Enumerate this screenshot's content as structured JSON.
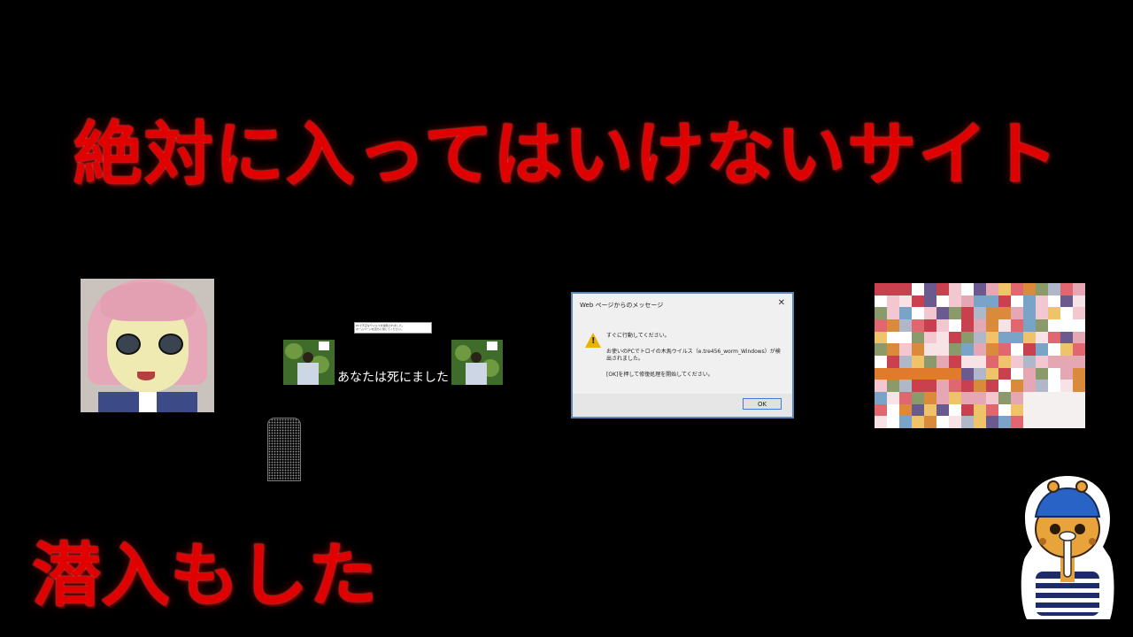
{
  "title": "絶対に入ってはいけないサイト",
  "subtitle": "潜入もした",
  "died_panel": {
    "caption": "あなたは死にました",
    "notice_lines": [
      "PCで不正なウイルスを検知されました。",
      "ホームページを直ちに閉じてください。"
    ]
  },
  "dialog": {
    "title": "Web ページからのメッセージ",
    "close_glyph": "✕",
    "line1": "すぐに行動してください。",
    "line2": "お使いのPCでトロイの木馬ウイルス（e.tre456_worm_Windows）が検",
    "line3": "出されました。",
    "line4": "[OK]を押して修復処理を開始してください。",
    "ok_label": "OK"
  },
  "colors": {
    "title_red": "#e00000",
    "background": "#000000",
    "dialog_border": "#5d89b8"
  },
  "icons": [
    "warning-icon",
    "close-icon"
  ]
}
